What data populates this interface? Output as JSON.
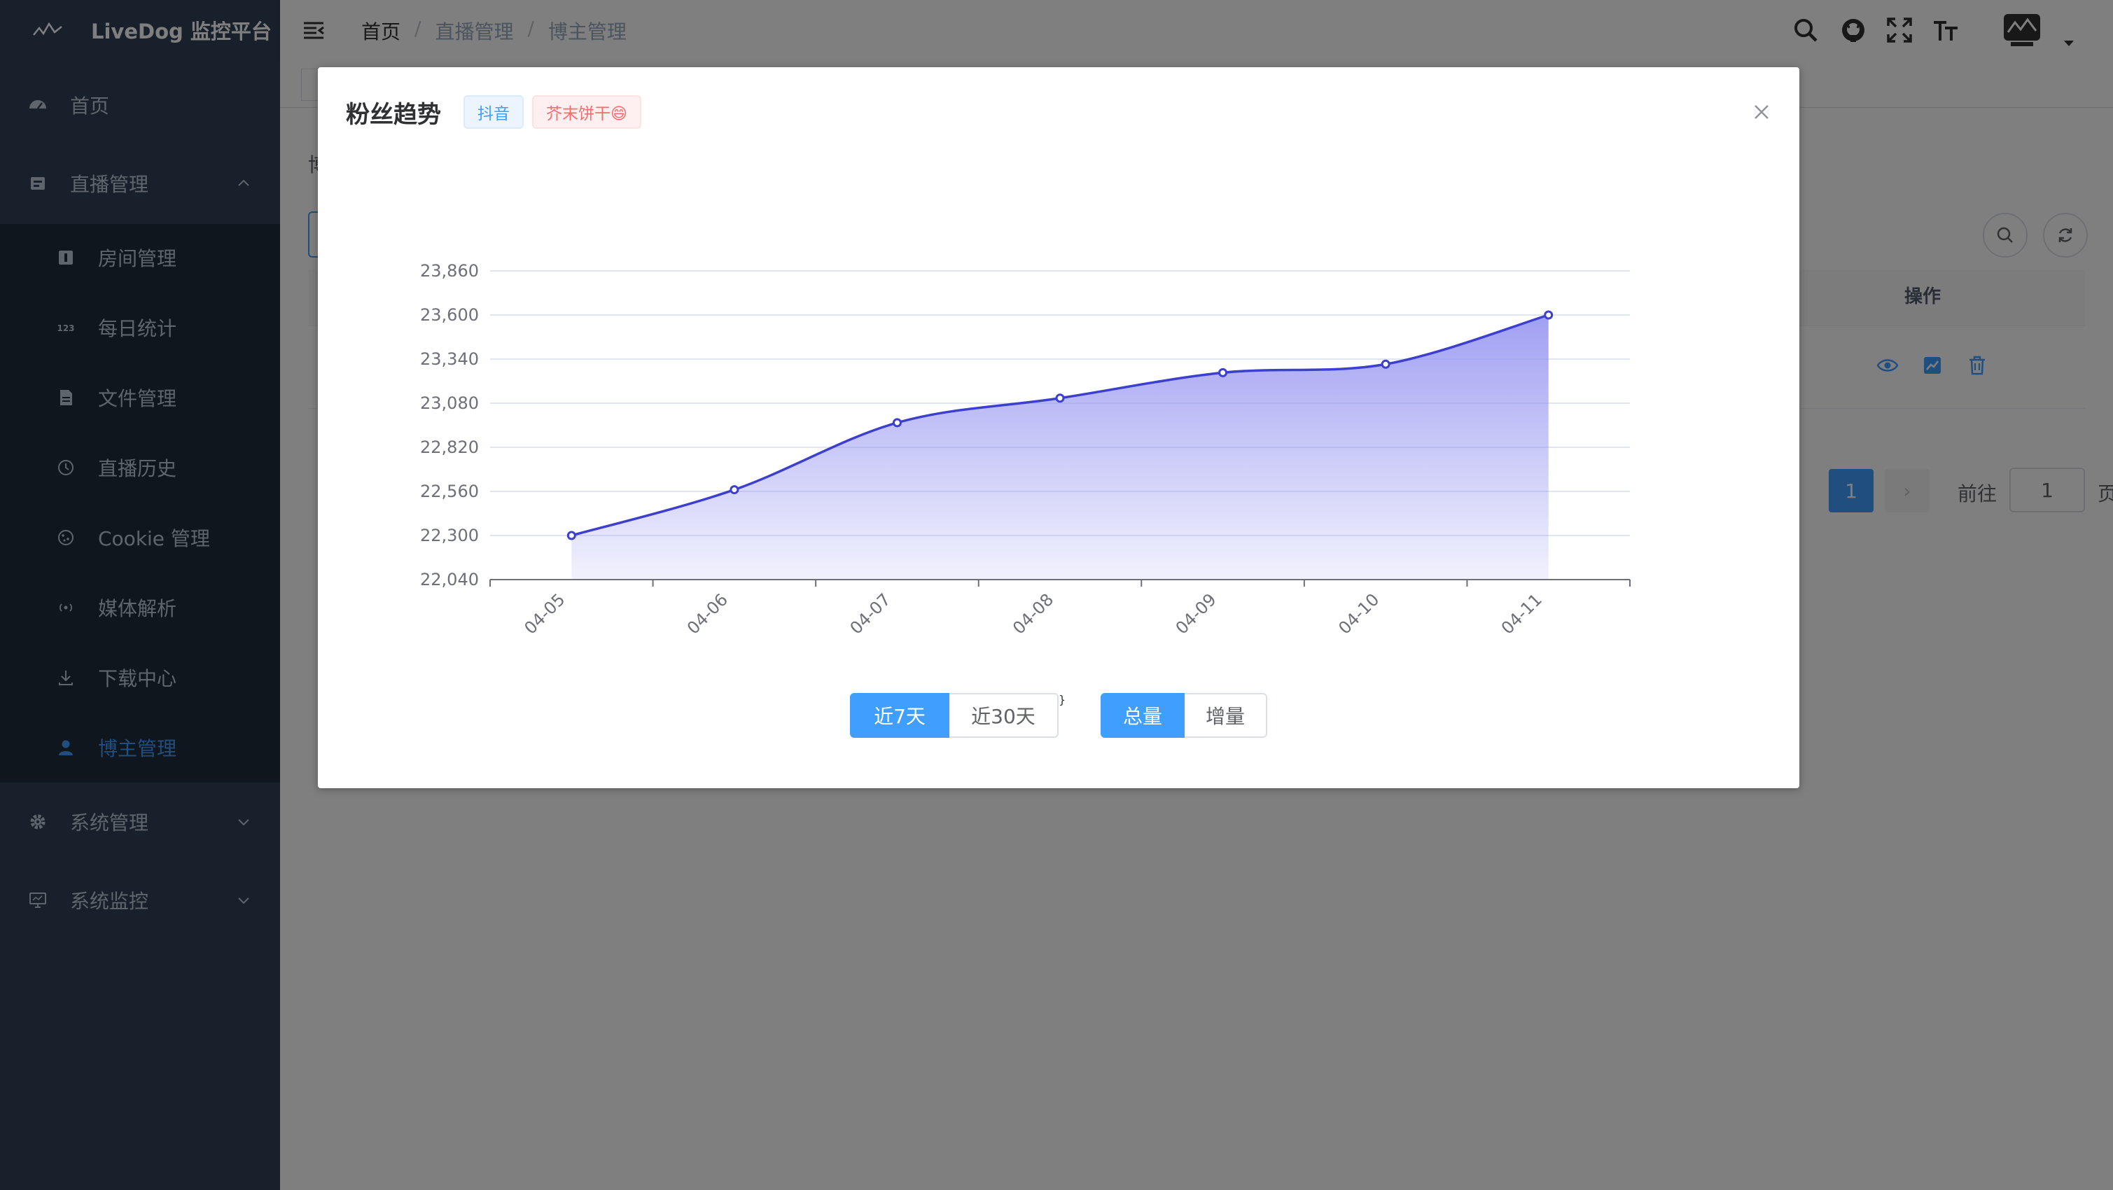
{
  "app": {
    "title": "LiveDog 监控平台"
  },
  "sidebar": {
    "items": [
      {
        "label": "首页",
        "icon": "dashboard-icon"
      },
      {
        "label": "直播管理",
        "icon": "live-icon"
      },
      {
        "label": "房间管理",
        "icon": "room-icon"
      },
      {
        "label": "每日统计",
        "icon": "numbers-icon"
      },
      {
        "label": "文件管理",
        "icon": "document-icon"
      },
      {
        "label": "直播历史",
        "icon": "history-icon"
      },
      {
        "label": "Cookie 管理",
        "icon": "cookie-icon"
      },
      {
        "label": "媒体解析",
        "icon": "broadcast-icon"
      },
      {
        "label": "下载中心",
        "icon": "download-icon"
      },
      {
        "label": "博主管理",
        "icon": "user-icon"
      },
      {
        "label": "系统管理",
        "icon": "gear-icon"
      },
      {
        "label": "系统监控",
        "icon": "monitor-icon"
      }
    ]
  },
  "breadcrumb": {
    "home": "首页",
    "sep": "/",
    "section": "直播管理",
    "current": "博主管理"
  },
  "background": {
    "title_fragment": "博",
    "table": {
      "action_header": "操作"
    },
    "pagination": {
      "current_page": "1",
      "next": "›",
      "goto_label": "前往",
      "goto_value": "1",
      "goto_suffix": "页"
    }
  },
  "dialog": {
    "title": "粉丝趋势",
    "tags": {
      "platform": "抖音",
      "user": "芥末饼干😄"
    },
    "range_buttons": [
      "近7天",
      "近30天"
    ],
    "mode_buttons": [
      "总量",
      "增量"
    ],
    "selected_range": "近7天",
    "selected_mode": "总量"
  },
  "chart_data": {
    "type": "area",
    "x": [
      "04-05",
      "04-06",
      "04-07",
      "04-08",
      "04-09",
      "04-10",
      "04-11"
    ],
    "values": [
      22300,
      22570,
      22965,
      23110,
      23260,
      23310,
      23600
    ],
    "ylim": [
      22040,
      23860
    ],
    "yticks": [
      "22,040",
      "22,300",
      "22,560",
      "22,820",
      "23,080",
      "23,340",
      "23,600",
      "23,860"
    ],
    "line_color": "#3c3fcf",
    "fill_color": "#8f8ff0",
    "grid": true
  },
  "colors": {
    "primary": "#409eff",
    "sidebar": "#304156",
    "submenu": "#1f2d3d"
  }
}
